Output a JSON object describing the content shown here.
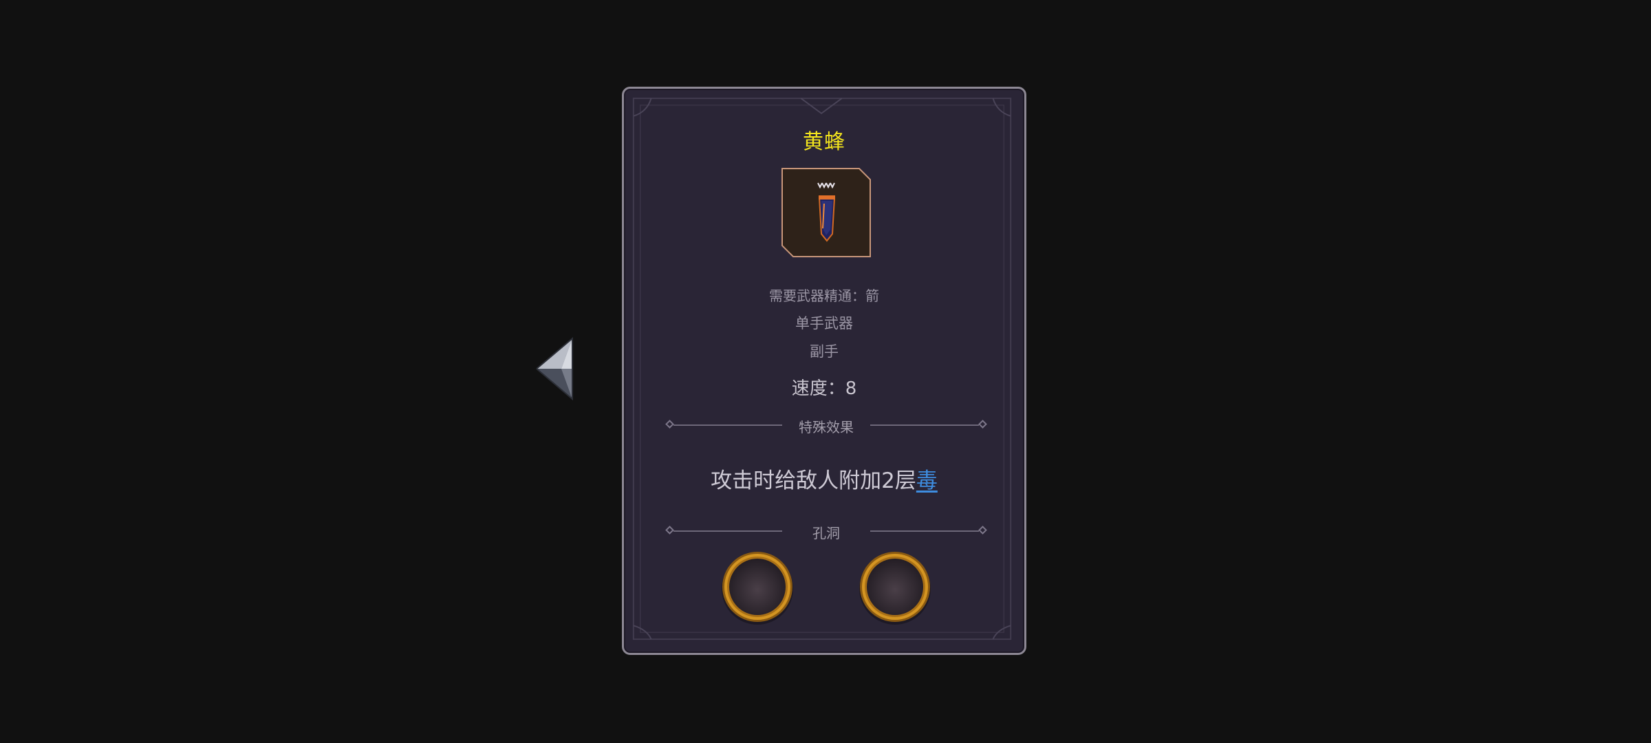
{
  "nav": {
    "back_icon": "back-arrow-gem-icon"
  },
  "item": {
    "name": "黄蜂",
    "name_color": "#f3e51d",
    "icon": "quiver-arrows-icon",
    "requirement": "需要武器精通：箭",
    "hand_type": "单手武器",
    "slot": "副手",
    "speed": "速度：8"
  },
  "effects": {
    "section_label": "特殊效果",
    "text_prefix": "攻击时给敌人附加2层",
    "keyword": "毒",
    "keyword_color": "#3e8de0"
  },
  "sockets": {
    "section_label": "孔洞",
    "slots": [
      {
        "icon": "empty-socket-icon"
      },
      {
        "icon": "empty-socket-icon"
      }
    ]
  }
}
